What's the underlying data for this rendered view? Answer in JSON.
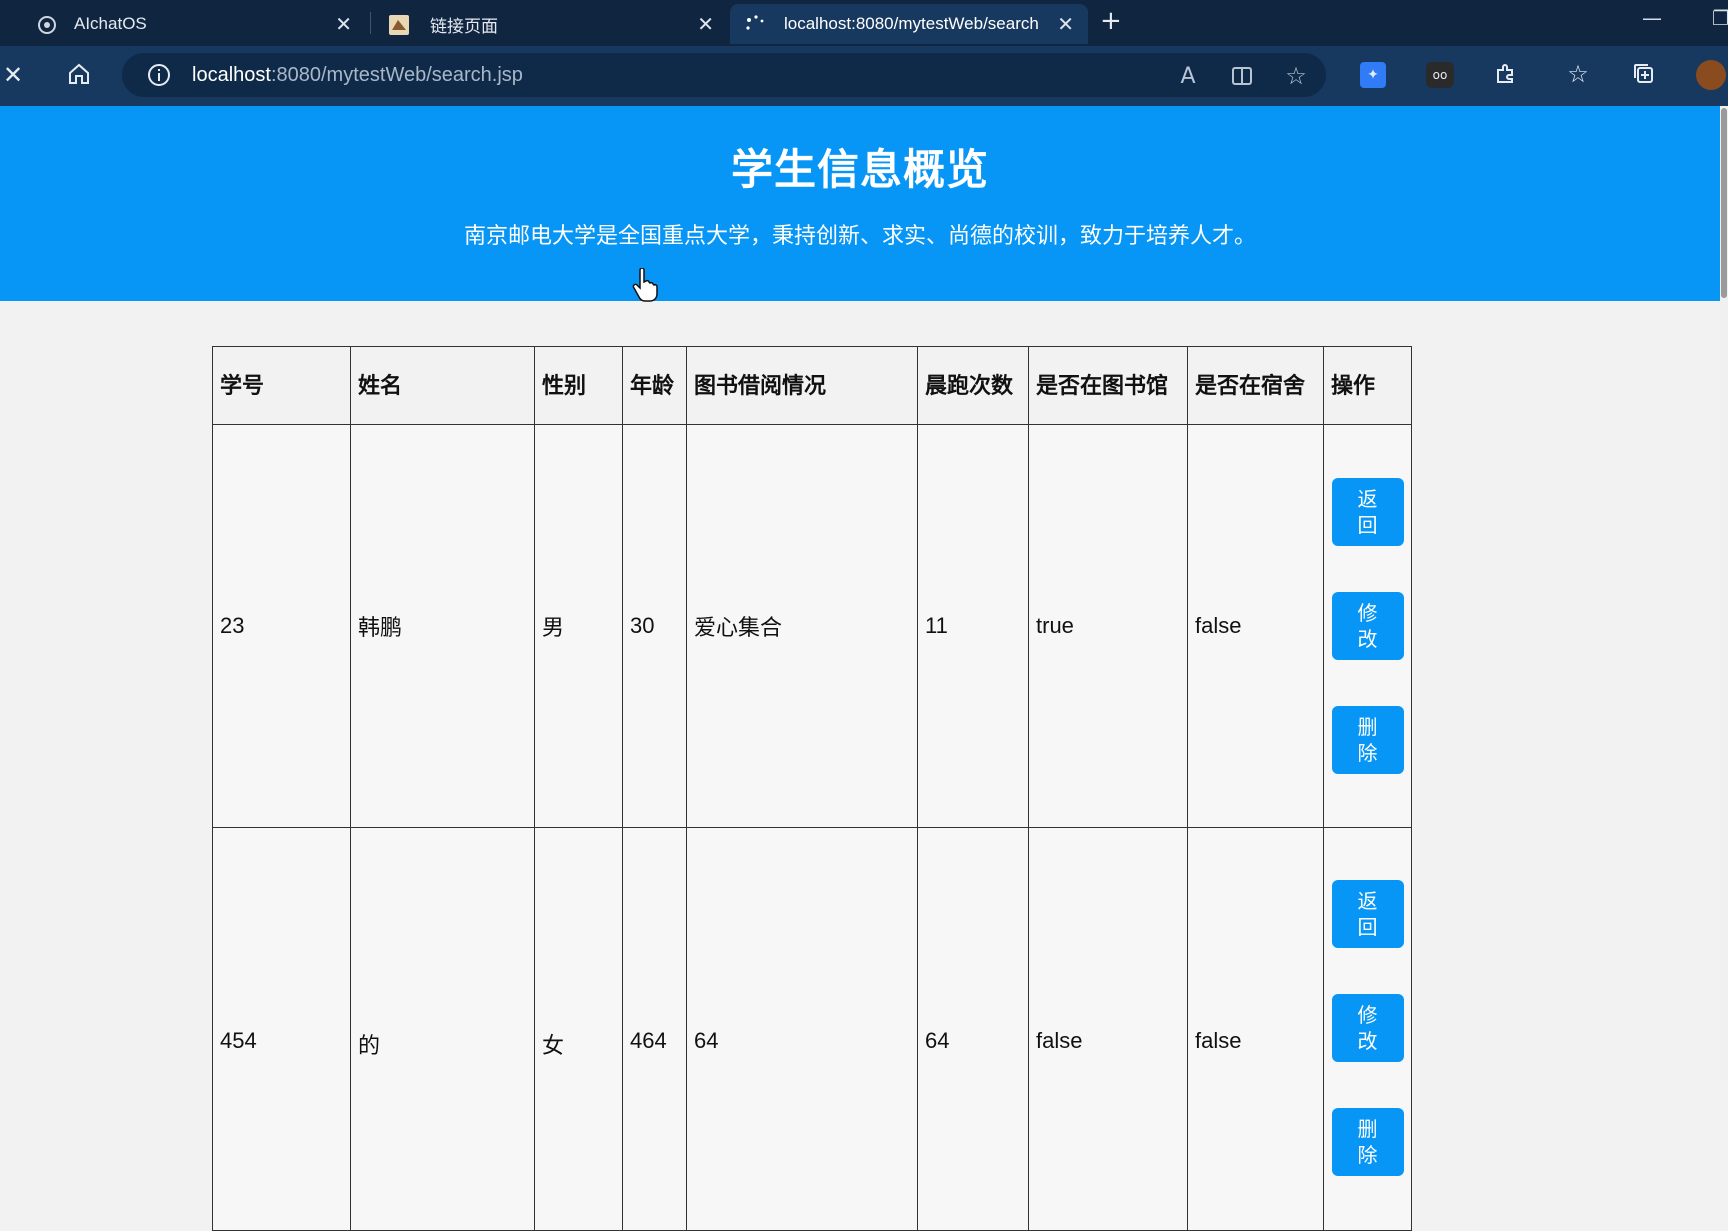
{
  "browser": {
    "tabs": [
      {
        "title": "AIchatOS",
        "active": false
      },
      {
        "title": "链接页面",
        "active": false
      },
      {
        "title": "localhost:8080/mytestWeb/search",
        "active": true
      }
    ],
    "address": {
      "host": "localhost",
      "rest": ":8080/mytestWeb/search.jsp"
    }
  },
  "page": {
    "title": "学生信息概览",
    "subtitle": "南京邮电大学是全国重点大学，秉持创新、求实、尚德的校训，致力于培养人才。"
  },
  "table": {
    "headers": [
      "学号",
      "姓名",
      "性别",
      "年龄",
      "图书借阅情况",
      "晨跑次数",
      "是否在图书馆",
      "是否在宿舍",
      "操作"
    ],
    "rows": [
      {
        "id": "23",
        "name": "韩鹏",
        "gender": "男",
        "age": "30",
        "books": "爱心集合",
        "runs": "11",
        "in_library": "true",
        "in_dorm": "false"
      },
      {
        "id": "454",
        "name": "的",
        "gender": "女",
        "age": "464",
        "books": "64",
        "runs": "64",
        "in_library": "false",
        "in_dorm": "false"
      }
    ],
    "actions": {
      "back": "返回",
      "edit": "修改",
      "delete": "删除"
    }
  }
}
